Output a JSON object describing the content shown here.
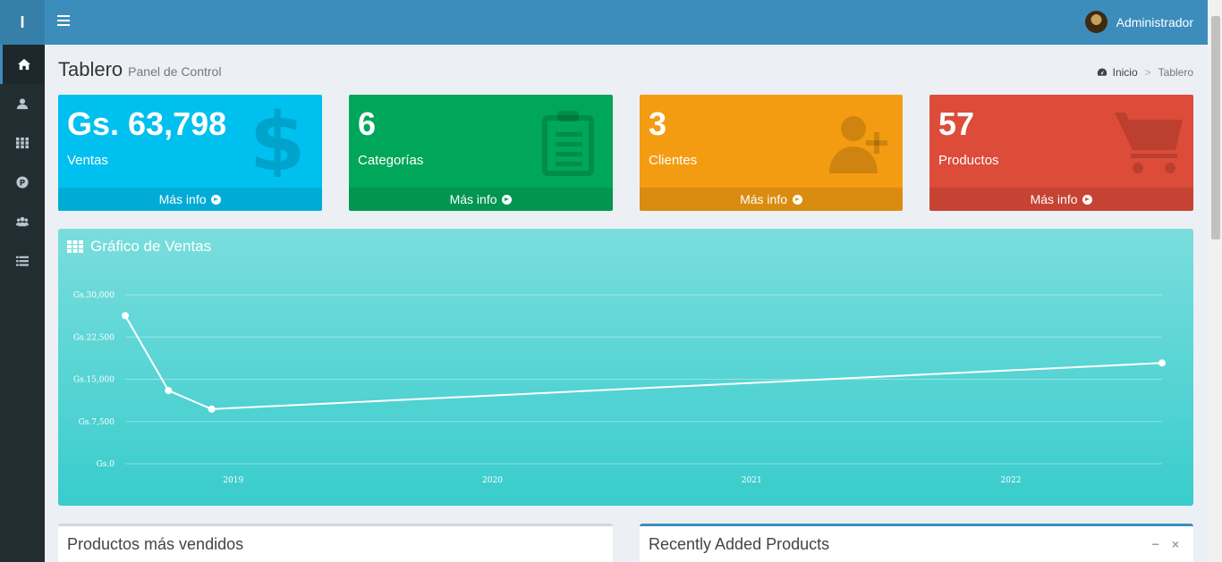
{
  "sidebar": {
    "logo": "I",
    "items": [
      {
        "icon": "home-icon"
      },
      {
        "icon": "user-icon"
      },
      {
        "icon": "th-icon"
      },
      {
        "icon": "product-p-icon"
      },
      {
        "icon": "users-icon"
      },
      {
        "icon": "list-icon"
      }
    ]
  },
  "header": {
    "user_name": "Administrador"
  },
  "content_header": {
    "title": "Tablero",
    "subtitle": "Panel de Control",
    "breadcrumb": [
      "Inicio",
      "Tablero"
    ]
  },
  "boxes": [
    {
      "value": "Gs. 63,798",
      "label": "Ventas",
      "link": "Más info",
      "color": "#00c0ef",
      "icon": "dollar-icon"
    },
    {
      "value": "6",
      "label": "Categorías",
      "link": "Más info",
      "color": "#00a65a",
      "icon": "clipboard-icon"
    },
    {
      "value": "3",
      "label": "Clientes",
      "link": "Más info",
      "color": "#f39c12",
      "icon": "user-plus-icon"
    },
    {
      "value": "57",
      "label": "Productos",
      "link": "Más info",
      "color": "#dd4b39",
      "icon": "cart-icon"
    }
  ],
  "chart": {
    "title": "Gráfico de Ventas"
  },
  "chart_data": {
    "type": "line",
    "title": "Gráfico de Ventas",
    "x": [
      "2018-08",
      "2018-10",
      "2018-12",
      "2022-08"
    ],
    "x_ticks": [
      "2019",
      "2020",
      "2021",
      "2022"
    ],
    "series": [
      {
        "values": [
          26300,
          13000,
          9700,
          17900
        ]
      }
    ],
    "ylim": [
      0,
      30000
    ],
    "y_ticks": [
      "Gs.0",
      "Gs.7,500",
      "Gs.15,000",
      "Gs.22,500",
      "Gs.30,000"
    ],
    "grid": true
  },
  "panels": {
    "top_products": "Productos más vendidos",
    "recent_products": "Recently Added Products",
    "minimize_glyph": "−",
    "close_glyph": "×"
  }
}
